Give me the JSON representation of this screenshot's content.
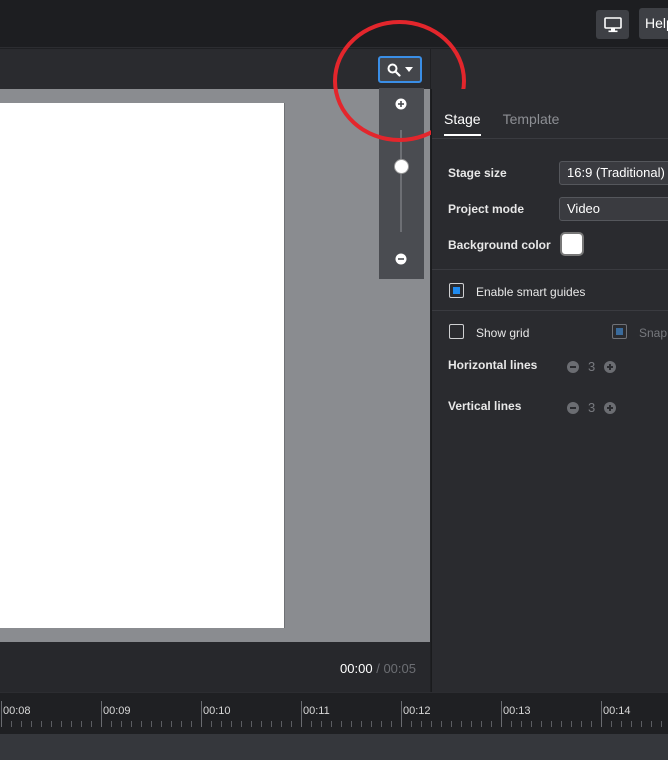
{
  "topbar": {
    "monitor_icon": "monitor-icon",
    "help_label": "Help"
  },
  "zoom": {
    "search_icon": "search-icon",
    "caret_icon": "caret-down-icon",
    "zoom_in_icon": "plus-circle-icon",
    "zoom_out_icon": "minus-circle-icon",
    "level": 0.5
  },
  "timecode": {
    "current": "00:00",
    "separator": "/",
    "total": "00:05"
  },
  "panel": {
    "tabs": [
      {
        "label": "Stage",
        "active": true
      },
      {
        "label": "Template",
        "active": false
      }
    ],
    "stage_size": {
      "label": "Stage size",
      "value": "16:9 (Traditional)"
    },
    "project_mode": {
      "label": "Project mode",
      "value": "Video"
    },
    "background_color": {
      "label": "Background color",
      "value": "#ffffff"
    },
    "smart_guides": {
      "label": "Enable smart guides",
      "checked": true
    },
    "show_grid": {
      "label": "Show grid",
      "checked": false
    },
    "snap": {
      "label": "Snap",
      "checked": true
    },
    "horizontal_lines": {
      "label": "Horizontal lines",
      "value": "3"
    },
    "vertical_lines": {
      "label": "Vertical lines",
      "value": "3"
    }
  },
  "timeline": {
    "ticks": [
      "00:08",
      "00:09",
      "00:10",
      "00:11",
      "00:12",
      "00:13",
      "00:14"
    ]
  },
  "colors": {
    "accent": "#1f8bf0",
    "highlight_circle": "#e3262c"
  }
}
